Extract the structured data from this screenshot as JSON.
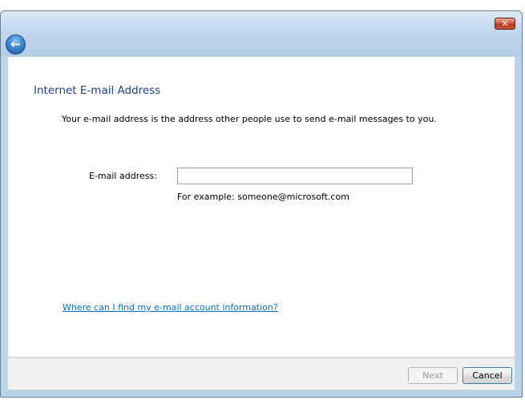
{
  "window": {
    "close_glyph": "✕",
    "back_glyph": "←"
  },
  "page": {
    "title": "Internet E-mail Address",
    "intro": "Your e-mail address is the address other people use to send e-mail messages to you."
  },
  "form": {
    "email_label": "E-mail address:",
    "email_value": "",
    "example": "For example: someone@microsoft.com"
  },
  "help_link": "Where can I find my e-mail account information?",
  "footer": {
    "next_label": "Next",
    "cancel_label": "Cancel"
  },
  "colors": {
    "title": "#1f3f8f",
    "link": "#0a6fc2",
    "frame": "#b9d3ea"
  }
}
